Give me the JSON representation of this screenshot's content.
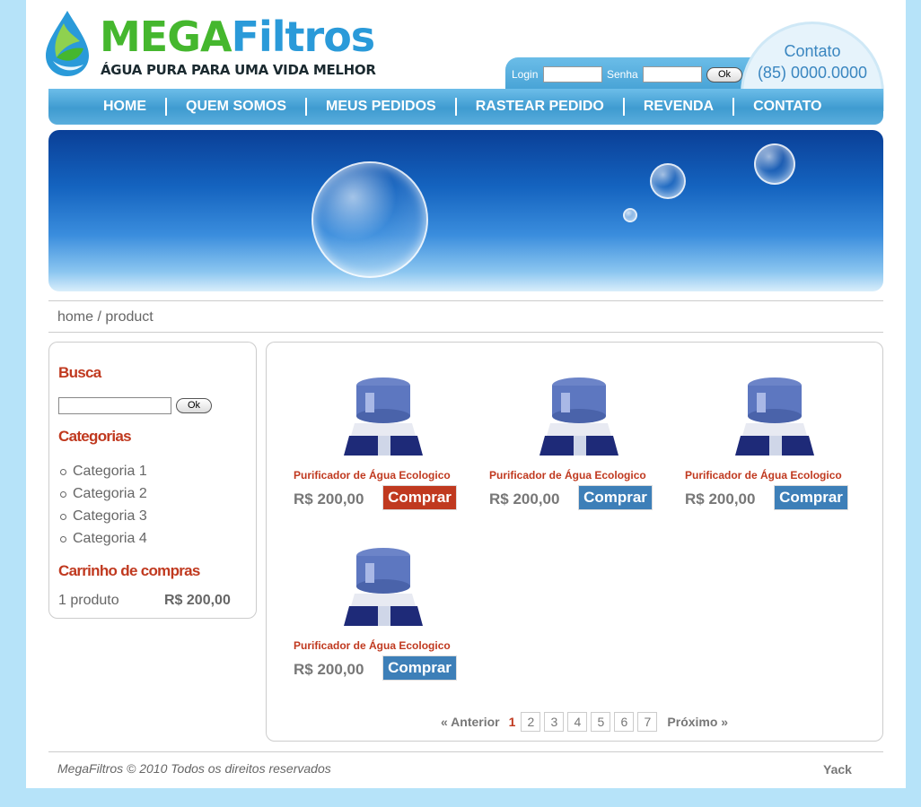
{
  "brand": {
    "name_part1": "MEGA",
    "name_part2": "Filtros",
    "tagline": "ÁGUA PURA PARA UMA VIDA MELHOR",
    "colors": {
      "green": "#45b72e",
      "blue": "#2a9ad9",
      "red": "#c0391f"
    }
  },
  "login": {
    "login_label": "Login",
    "password_label": "Senha",
    "login_value": "",
    "password_value": "",
    "ok_label": "Ok"
  },
  "contact": {
    "title": "Contato",
    "phone": "(85) 0000.0000"
  },
  "nav": {
    "items": [
      {
        "label": "HOME"
      },
      {
        "label": "QUEM SOMOS"
      },
      {
        "label": "MEUS PEDIDOS"
      },
      {
        "label": "RASTEAR PEDIDO"
      },
      {
        "label": "REVENDA"
      },
      {
        "label": "CONTATO"
      }
    ]
  },
  "breadcrumb": "home / product",
  "sidebar": {
    "search_title": "Busca",
    "search_value": "",
    "search_ok": "Ok",
    "categories_title": "Categorias",
    "categories": [
      {
        "label": "Categoria 1"
      },
      {
        "label": "Categoria 2"
      },
      {
        "label": "Categoria 3"
      },
      {
        "label": "Categoria 4"
      }
    ],
    "cart_title": "Carrinho de compras",
    "cart_qty": "1 produto",
    "cart_total": "R$ 200,00"
  },
  "products": [
    {
      "name": "Purificador de Água Ecologico",
      "price": "R$ 200,00",
      "buy_label": "Comprar",
      "buy_color": "#c0391f"
    },
    {
      "name": "Purificador de Água Ecologico",
      "price": "R$ 200,00",
      "buy_label": "Comprar",
      "buy_color": "#3d7fb8"
    },
    {
      "name": "Purificador de Água Ecologico",
      "price": "R$ 200,00",
      "buy_label": "Comprar",
      "buy_color": "#3d7fb8"
    },
    {
      "name": "Purificador de Água Ecologico",
      "price": "R$ 200,00",
      "buy_label": "Comprar",
      "buy_color": "#3d7fb8"
    }
  ],
  "pagination": {
    "prev": "« Anterior",
    "current": "1",
    "pages": [
      "2",
      "3",
      "4",
      "5",
      "6",
      "7"
    ],
    "next": "Próximo »"
  },
  "footer": {
    "copyright": "MegaFiltros © 2010 Todos os direitos reservados",
    "credit": "Yack"
  }
}
